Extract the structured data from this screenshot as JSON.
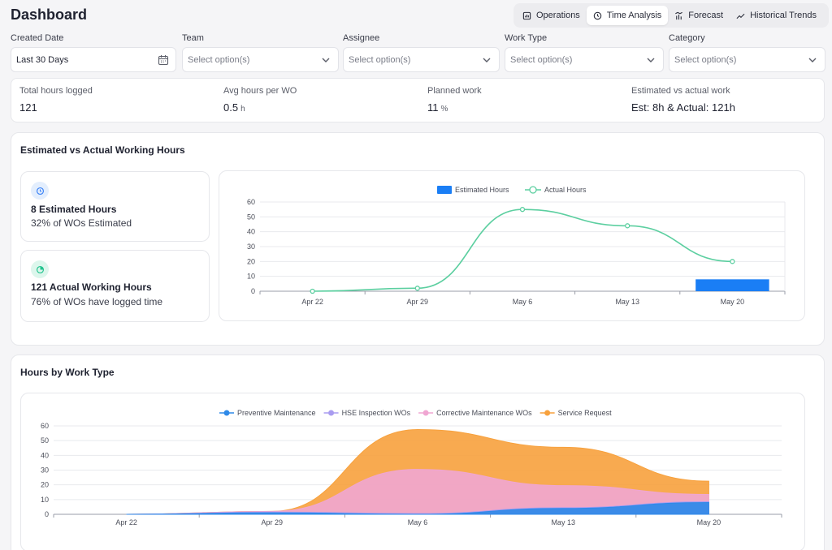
{
  "header": {
    "title": "Dashboard"
  },
  "tabs": [
    {
      "label": "Operations",
      "icon": "report-icon",
      "active": false
    },
    {
      "label": "Time Analysis",
      "icon": "clock-icon",
      "active": true
    },
    {
      "label": "Forecast",
      "icon": "forecast-icon",
      "active": false
    },
    {
      "label": "Historical Trends",
      "icon": "trend-icon",
      "active": false
    }
  ],
  "filters": [
    {
      "label": "Created Date",
      "value": "Last 30 Days",
      "placeholder": "",
      "icon": "calendar-icon"
    },
    {
      "label": "Team",
      "value": "",
      "placeholder": "Select option(s)",
      "icon": "chevron-down-icon"
    },
    {
      "label": "Assignee",
      "value": "",
      "placeholder": "Select option(s)",
      "icon": "chevron-down-icon"
    },
    {
      "label": "Work Type",
      "value": "",
      "placeholder": "Select option(s)",
      "icon": "chevron-down-icon"
    },
    {
      "label": "Category",
      "value": "",
      "placeholder": "Select option(s)",
      "icon": "chevron-down-icon"
    }
  ],
  "kpis": [
    {
      "label": "Total hours logged",
      "value": "121",
      "unit": ""
    },
    {
      "label": "Avg hours per WO",
      "value": "0.5",
      "unit": "h"
    },
    {
      "label": "Planned work",
      "value": "11",
      "unit": "%"
    },
    {
      "label": "Estimated vs actual work",
      "value": "Est: 8h & Actual: 121h",
      "unit": ""
    }
  ],
  "estimated_panel": {
    "title": "Estimated vs Actual Working Hours",
    "estimated_card": {
      "main": "8 Estimated Hours",
      "sub": "32% of WOs Estimated",
      "icon": "clock-icon",
      "color": "#3b82f6"
    },
    "actual_card": {
      "main": "121 Actual Working Hours",
      "sub": "76% of WOs have logged time",
      "icon": "timer-icon",
      "color": "#22c38e"
    }
  },
  "worktype_panel": {
    "title": "Hours by Work Type"
  },
  "chart_data": [
    {
      "type": "bar+line",
      "categories": [
        "Apr 22",
        "Apr 29",
        "May 6",
        "May 13",
        "May 20"
      ],
      "series": [
        {
          "name": "Estimated Hours",
          "kind": "bar",
          "color": "#1a7ef5",
          "values": [
            0,
            0,
            0,
            0,
            8
          ]
        },
        {
          "name": "Actual Hours",
          "kind": "line",
          "color": "#5ccfa0",
          "values": [
            0,
            2,
            55,
            44,
            20
          ]
        }
      ],
      "yticks": [
        "0",
        "10",
        "20",
        "30",
        "40",
        "50",
        "60"
      ],
      "ylim": [
        0,
        60
      ],
      "legend": "top-center"
    },
    {
      "type": "area",
      "stacked": true,
      "categories": [
        "Apr 22",
        "Apr 29",
        "May 6",
        "May 13",
        "May 20"
      ],
      "series": [
        {
          "name": "Preventive Maintenance",
          "color": "#2f8ae8",
          "values": [
            0,
            1,
            0,
            4,
            8
          ]
        },
        {
          "name": "HSE Inspection WOs",
          "color": "#a99cf0",
          "values": [
            0,
            0.5,
            0.5,
            0.5,
            0.5
          ]
        },
        {
          "name": "Corrective Maintenance WOs",
          "color": "#f0a6d2",
          "values": [
            0,
            0.5,
            30,
            15,
            5
          ]
        },
        {
          "name": "Service Request",
          "color": "#f7a13d",
          "values": [
            0,
            0,
            27,
            26,
            9
          ]
        }
      ],
      "yticks": [
        "0",
        "10",
        "20",
        "30",
        "40",
        "50",
        "60"
      ],
      "ylim": [
        0,
        60
      ],
      "legend": "top-center"
    }
  ]
}
